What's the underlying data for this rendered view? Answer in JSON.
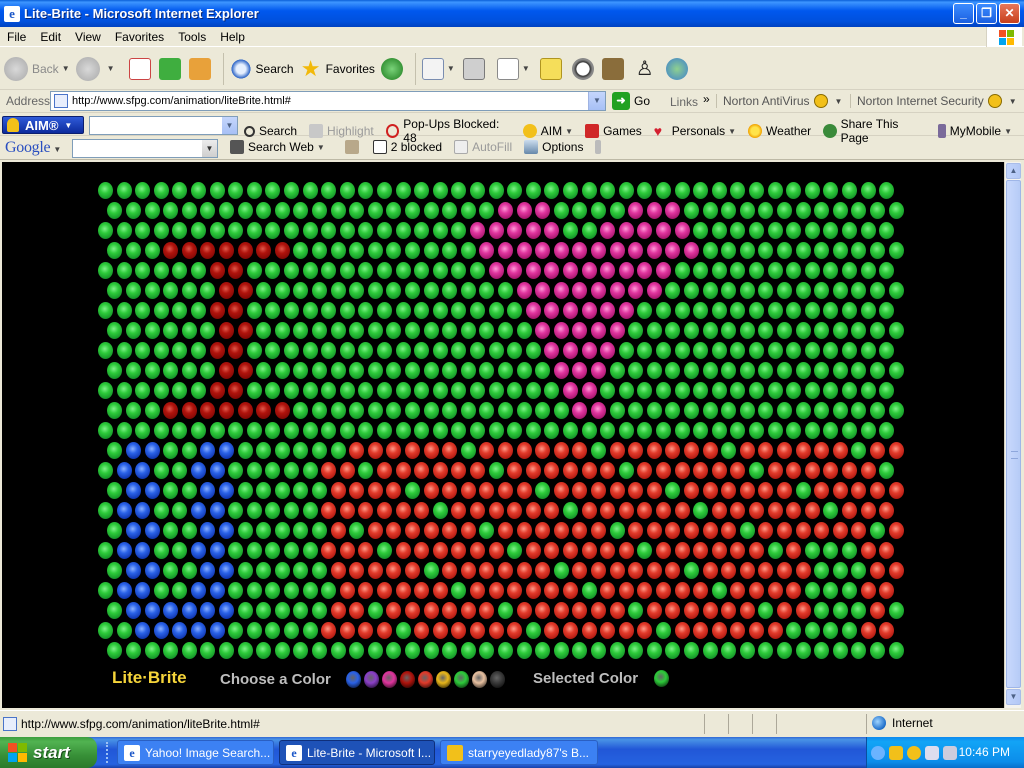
{
  "window": {
    "title": "Lite-Brite - Microsoft Internet Explorer"
  },
  "menu": [
    "File",
    "Edit",
    "View",
    "Favorites",
    "Tools",
    "Help"
  ],
  "toolbar": {
    "back": "Back",
    "search": "Search",
    "favorites": "Favorites"
  },
  "address": {
    "label": "Address",
    "url": "http://www.sfpg.com/animation/liteBrite.html#",
    "go": "Go",
    "links": "Links",
    "norton_av": "Norton AntiVirus",
    "norton_is": "Norton Internet Security"
  },
  "aim": {
    "logo": "AIM®",
    "search": "Search",
    "highlight": "Highlight",
    "popups": "Pop-Ups Blocked: 48",
    "aim": "AIM",
    "games": "Games",
    "personals": "Personals",
    "weather": "Weather",
    "share": "Share This Page",
    "mymobile": "MyMobile"
  },
  "google": {
    "logo": "Google",
    "search_web": "Search Web",
    "blocked": "2 blocked",
    "autofill": "AutoFill",
    "options": "Options"
  },
  "litebrite": {
    "brand": "Lite·Brite",
    "choose": "Choose a Color",
    "selected": "Selected Color",
    "selected_color": "#2DCB3A",
    "swatches": [
      "#2A62E8",
      "#8A3FC8",
      "#E0349E",
      "#B0130C",
      "#E23A2A",
      "#E8B61A",
      "#2DCB3A",
      "#E8C0A0",
      "#3a3a3a"
    ],
    "grid_cols": 43,
    "grid_rows": 24
  },
  "status": {
    "text": "http://www.sfpg.com/animation/liteBrite.html#",
    "zone": "Internet"
  },
  "taskbar": {
    "start": "start",
    "tasks": [
      "Yahoo! Image Search...",
      "Lite-Brite - Microsoft I...",
      "starryeyedlady87's B..."
    ],
    "clock": "10:46 PM"
  }
}
